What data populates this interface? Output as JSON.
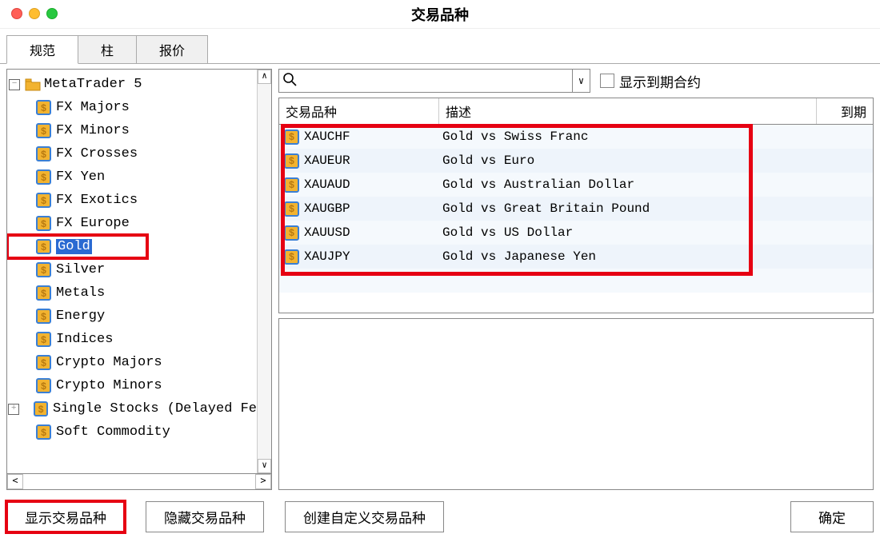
{
  "window": {
    "title": "交易品种"
  },
  "tabs": [
    {
      "label": "规范",
      "active": true
    },
    {
      "label": "柱",
      "active": false
    },
    {
      "label": "报价",
      "active": false
    }
  ],
  "tree": {
    "root": "MetaTrader 5",
    "items": [
      {
        "label": "FX Majors"
      },
      {
        "label": "FX Minors"
      },
      {
        "label": "FX Crosses"
      },
      {
        "label": "FX Yen"
      },
      {
        "label": "FX Exotics"
      },
      {
        "label": "FX Europe"
      },
      {
        "label": "Gold",
        "selected": true
      },
      {
        "label": "Silver"
      },
      {
        "label": "Metals"
      },
      {
        "label": "Energy"
      },
      {
        "label": "Indices"
      },
      {
        "label": "Crypto Majors"
      },
      {
        "label": "Crypto Minors"
      },
      {
        "label": "Single Stocks (Delayed Fe",
        "hasChildren": true
      },
      {
        "label": "Soft Commodity"
      }
    ]
  },
  "search": {
    "value": ""
  },
  "expired_checkbox": {
    "label": "显示到期合约",
    "checked": false
  },
  "grid": {
    "columns": {
      "symbol": "交易品种",
      "description": "描述",
      "expiry": "到期"
    },
    "rows": [
      {
        "symbol": "XAUCHF",
        "description": "Gold vs Swiss Franc"
      },
      {
        "symbol": "XAUEUR",
        "description": "Gold vs Euro"
      },
      {
        "symbol": "XAUAUD",
        "description": "Gold vs Australian Dollar"
      },
      {
        "symbol": "XAUGBP",
        "description": "Gold vs Great Britain Pound"
      },
      {
        "symbol": "XAUUSD",
        "description": "Gold vs US Dollar"
      },
      {
        "symbol": "XAUJPY",
        "description": "Gold vs Japanese Yen"
      }
    ]
  },
  "footer": {
    "show": "显示交易品种",
    "hide": "隐藏交易品种",
    "create": "创建自定义交易品种",
    "ok": "确定"
  }
}
